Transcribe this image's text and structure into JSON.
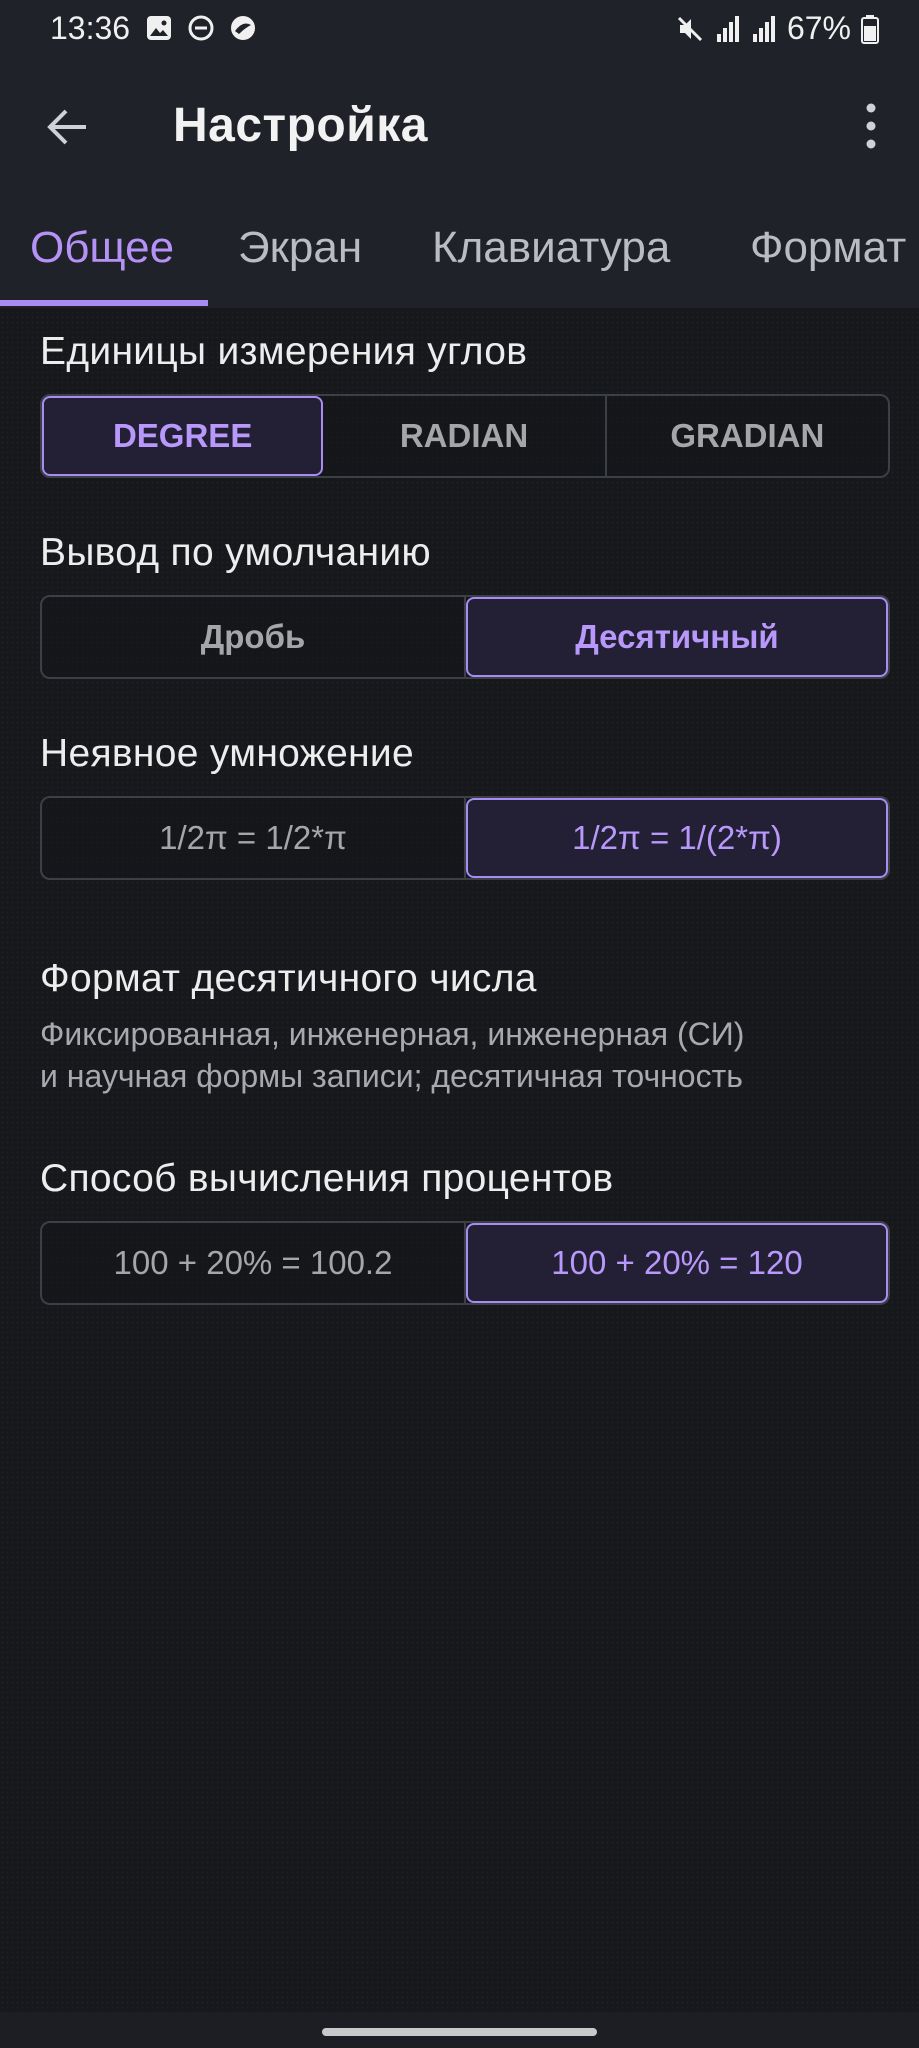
{
  "status_bar": {
    "time": "13:36",
    "left_icons": [
      "gallery-icon",
      "dnd-icon",
      "app-notification-icon"
    ],
    "right_icons": [
      "mute-icon",
      "signal-icon",
      "signal-icon"
    ],
    "battery": "67%"
  },
  "app_bar": {
    "title": "Настройка",
    "back_icon": "arrow-left-icon",
    "menu_icon": "more-vert-icon"
  },
  "tabs": [
    {
      "label": "Общее",
      "active": true
    },
    {
      "label": "Экран",
      "active": false
    },
    {
      "label": "Клавиатура",
      "active": false
    },
    {
      "label": "Формат",
      "active": false
    }
  ],
  "settings": {
    "angle_units": {
      "title": "Единицы измерения углов",
      "options": [
        "DEGREE",
        "RADIAN",
        "GRADIAN"
      ],
      "selected": 0
    },
    "default_output": {
      "title": "Вывод по умолчанию",
      "options": [
        "Дробь",
        "Десятичный"
      ],
      "selected": 1
    },
    "implicit_multiplication": {
      "title": "Неявное умножение",
      "options": [
        "1/2π = 1/2*π",
        "1/2π = 1/(2*π)"
      ],
      "selected": 1
    },
    "decimal_format": {
      "title": "Формат десятичного числа",
      "subtitle_line1": "Фиксированная, инженерная, инженерная (СИ)",
      "subtitle_line2": "и научная формы записи; десятичная точность"
    },
    "percent_method": {
      "title": "Способ вычисления процентов",
      "options": [
        "100 + 20% = 100.2",
        "100 + 20% = 120"
      ],
      "selected": 1
    }
  },
  "colors": {
    "accent": "#b692f6",
    "background": "#16181c",
    "bar": "#1f2228"
  }
}
